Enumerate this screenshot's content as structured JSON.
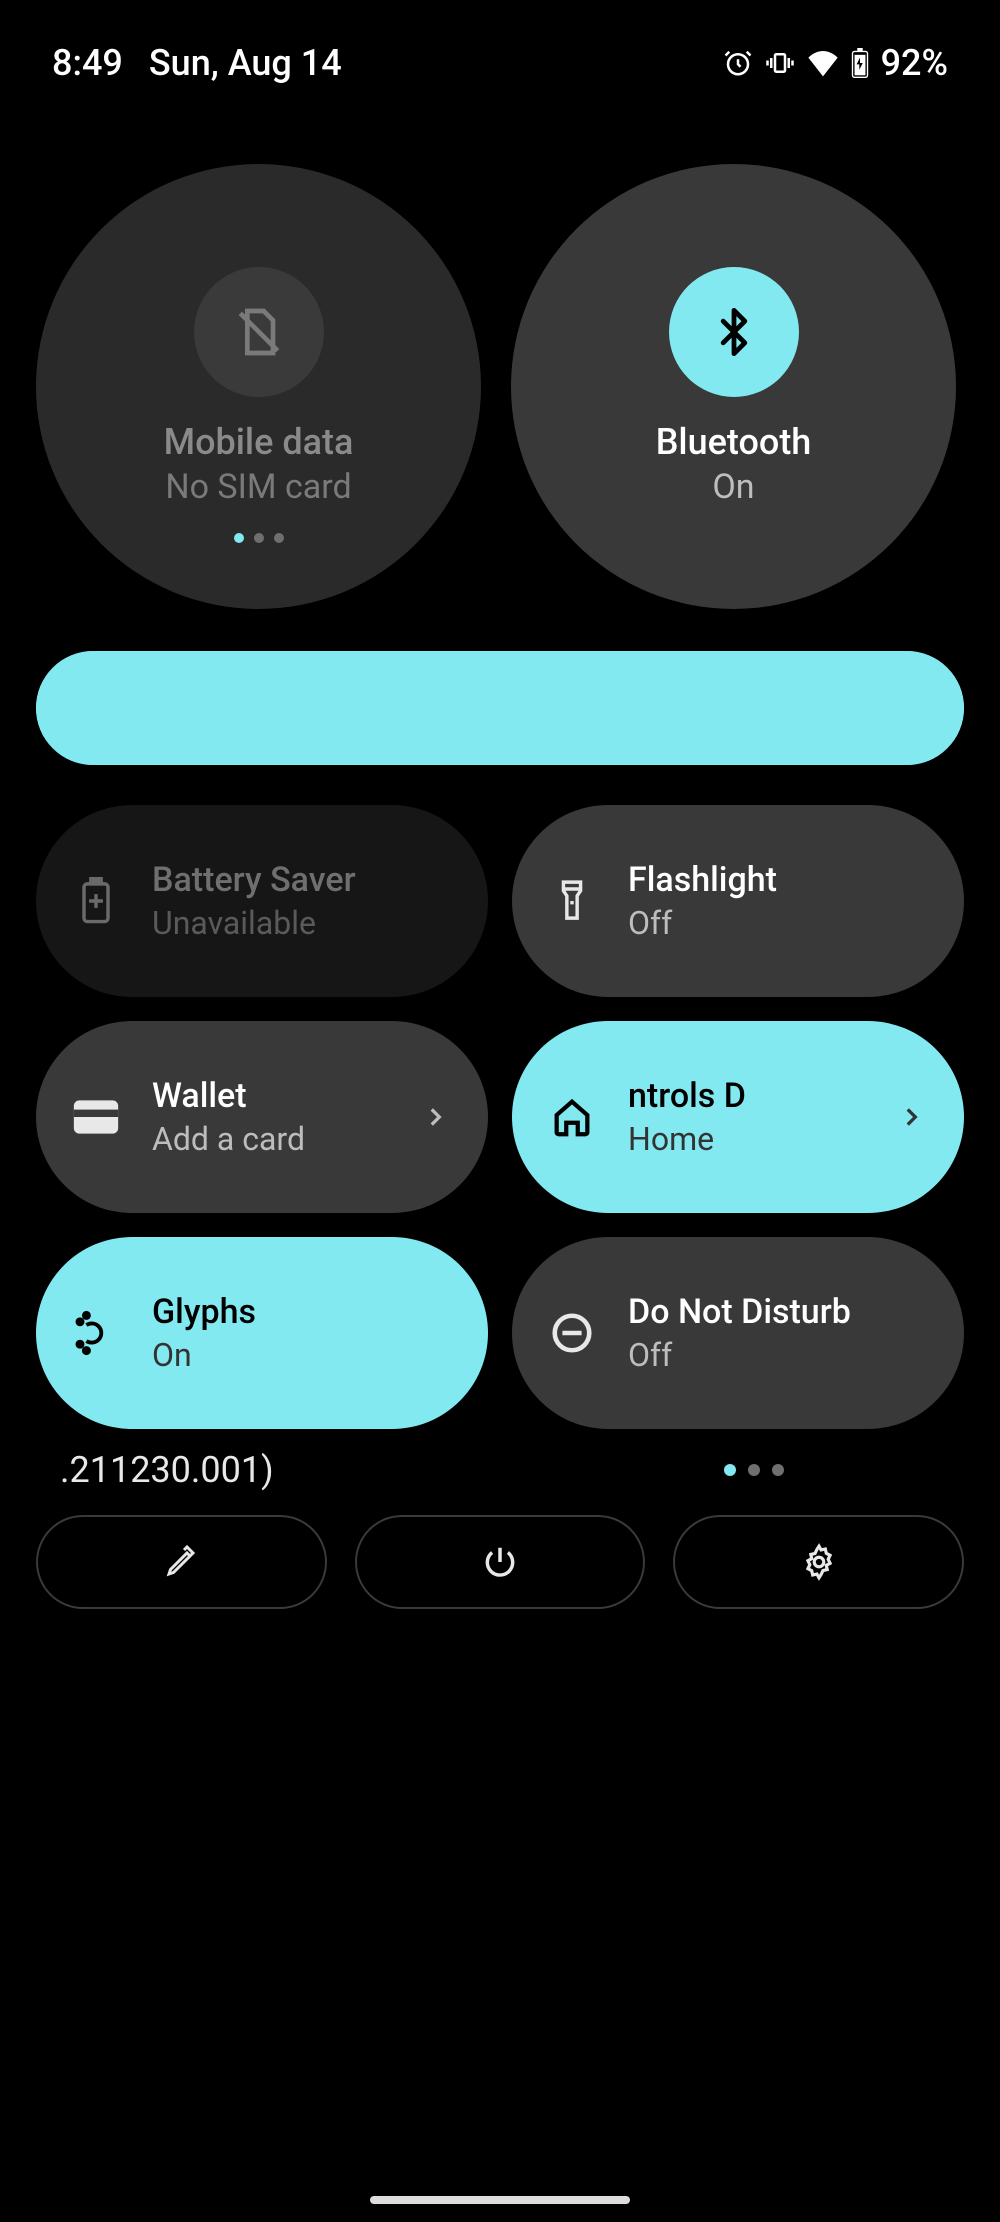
{
  "status": {
    "time": "8:49",
    "date": "Sun, Aug 14",
    "battery_pct": "92%"
  },
  "circles": {
    "mobile_data": {
      "title": "Mobile data",
      "sub": "No SIM card"
    },
    "bluetooth": {
      "title": "Bluetooth",
      "sub": "On"
    }
  },
  "brightness": {
    "percent": 100
  },
  "tiles": {
    "battery_saver": {
      "title": "Battery Saver",
      "sub": "Unavailable"
    },
    "flashlight": {
      "title": "Flashlight",
      "sub": "Off"
    },
    "wallet": {
      "title": "Wallet",
      "sub": "Add a card"
    },
    "device_controls": {
      "title": "ntrols       D",
      "sub": "Home"
    },
    "glyphs": {
      "title": "Glyphs",
      "sub": "On"
    },
    "dnd": {
      "title": "Do Not Disturb",
      "sub": "Off"
    }
  },
  "build": ".211230.001)",
  "colors": {
    "accent": "#82e9f0",
    "tile": "#393939",
    "tile_dim": "#161616"
  }
}
